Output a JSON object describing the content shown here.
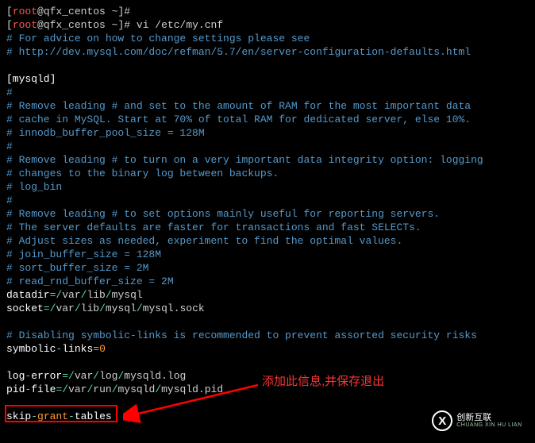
{
  "prompt": {
    "lb": "[",
    "user": "root",
    "at": "@",
    "host": "qfx_centos",
    "tilde": " ~",
    "rb": "]",
    "hash": "#"
  },
  "command": "vi /etc/my.cnf",
  "lines": {
    "c1": "# For advice on how to change settings please see",
    "c2": "# http://dev.mysql.com/doc/refman/5.7/en/server-configuration-defaults.html",
    "section": "[mysqld]",
    "h": "#",
    "c3": "# Remove leading # and set to the amount of RAM for the most important data",
    "c4": "# cache in MySQL. Start at 70% of total RAM for dedicated server, else 10%.",
    "c5": "# innodb_buffer_pool_size = 128M",
    "c6": "# Remove leading # to turn on a very important data integrity option: logging",
    "c7": "# changes to the binary log between backups.",
    "c8": "# log_bin",
    "c9": "# Remove leading # to set options mainly useful for reporting servers.",
    "c10": "# The server defaults are faster for transactions and fast SELECTs.",
    "c11": "# Adjust sizes as needed, experiment to find the optimal values.",
    "c12": "# join_buffer_size = 128M",
    "c13": "# sort_buffer_size = 2M",
    "c14": "# read_rnd_buffer_size = 2M"
  },
  "kv": {
    "datadir_k": "datadir",
    "datadir_v1": "var",
    "datadir_v2": "lib",
    "datadir_v3": "mysql",
    "socket_k": "socket",
    "socket_v1": "var",
    "socket_v2": "lib",
    "socket_v3": "mysql",
    "socket_v4": "mysql.sock",
    "disabling": "# Disabling symbolic-links is recommended to prevent assorted security risks",
    "sym_k": "symbolic",
    "sym_k2": "links",
    "sym_v": "0",
    "log_k": "log",
    "log_k2": "error",
    "log_v1": "var",
    "log_v2": "log",
    "log_v3": "mysqld.log",
    "pid_k": "pid",
    "pid_k2": "file",
    "pid_v1": "var",
    "pid_v2": "run",
    "pid_v3": "mysqld",
    "pid_v4": "mysqld.pid",
    "skip1": "skip",
    "skip2": "grant",
    "skip3": "tables"
  },
  "annotation": "添加此信息,并保存退出",
  "watermark": {
    "icon": "X",
    "cn": "创新互联",
    "en": "CHUANG XIN HU LIAN"
  }
}
